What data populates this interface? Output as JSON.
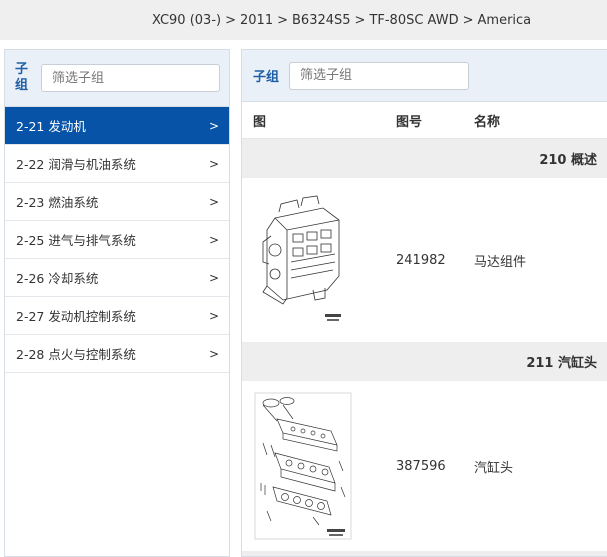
{
  "breadcrumb": [
    "XC90 (03-)",
    "2011",
    "B6324S5",
    "TF-80SC AWD",
    "America"
  ],
  "breadcrumb_separator": ">",
  "left_panel": {
    "label": "子组",
    "filter_placeholder": "筛选子组",
    "items": [
      {
        "label": "2-21 发动机",
        "active": true
      },
      {
        "label": "2-22 润滑与机油系统",
        "active": false
      },
      {
        "label": "2-23 燃油系统",
        "active": false
      },
      {
        "label": "2-25 进气与排气系统",
        "active": false
      },
      {
        "label": "2-26 冷却系统",
        "active": false
      },
      {
        "label": "2-27 发动机控制系统",
        "active": false
      },
      {
        "label": "2-28 点火与控制系统",
        "active": false
      }
    ],
    "chevron": ">"
  },
  "right_panel": {
    "label": "子组",
    "filter_placeholder": "筛选子组",
    "columns": {
      "image": "图",
      "number": "图号",
      "name": "名称"
    },
    "groups": [
      {
        "title": "210 概述",
        "part": {
          "number": "241982",
          "name": "马达组件",
          "icon": "engine-assembly-icon"
        }
      },
      {
        "title": "211 汽缸头",
        "part": {
          "number": "387596",
          "name": "汽缸头",
          "icon": "cylinder-head-icon"
        }
      }
    ]
  },
  "colors": {
    "accent": "#0753a8",
    "header_bg": "#e9f0f8",
    "group_bg": "#eeeeee"
  }
}
